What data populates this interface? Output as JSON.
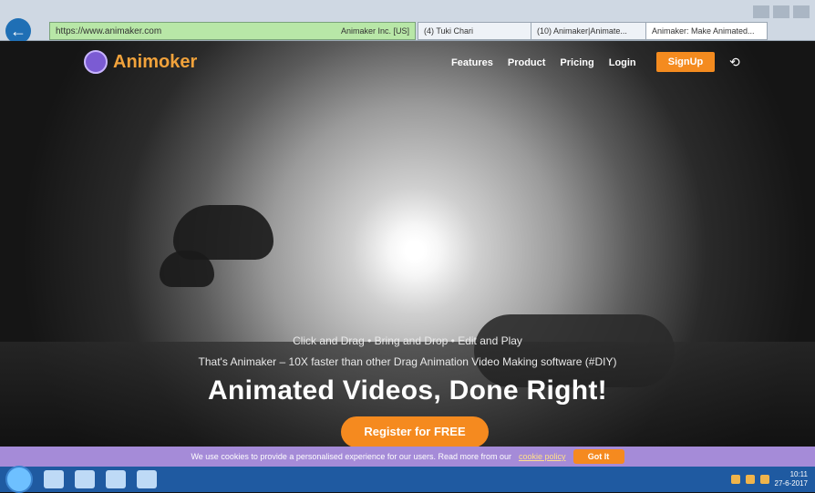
{
  "browser": {
    "back_icon": "back-arrow-icon",
    "address_url": "https://www.animaker.com",
    "address_site_name": "Animaker Inc. [US]",
    "tabs": [
      {
        "label": "(4) Tuki Chari"
      },
      {
        "label": "(10) Animaker|Animate..."
      },
      {
        "label": "Animaker: Make Animated..."
      }
    ]
  },
  "page": {
    "logo_text": "Animoker",
    "nav": [
      "Features",
      "Product",
      "Pricing",
      "Login"
    ],
    "signup_label": "SignUp",
    "hero": {
      "line1": "Click and Drag • Bring and Drop • Edit and Play",
      "line2": "That's Animaker – 10X faster than other Drag Animation Video Making software (#DIY)",
      "title": "Animated Videos, Done Right!",
      "cta": "Register for FREE"
    }
  },
  "cookie": {
    "text": "We use cookies to provide a personalised experience for our users. Read more from our",
    "link": "cookie policy",
    "button": "Got It"
  },
  "taskbar": {
    "clock_time": "10:11",
    "clock_date": "27-6-2017"
  }
}
